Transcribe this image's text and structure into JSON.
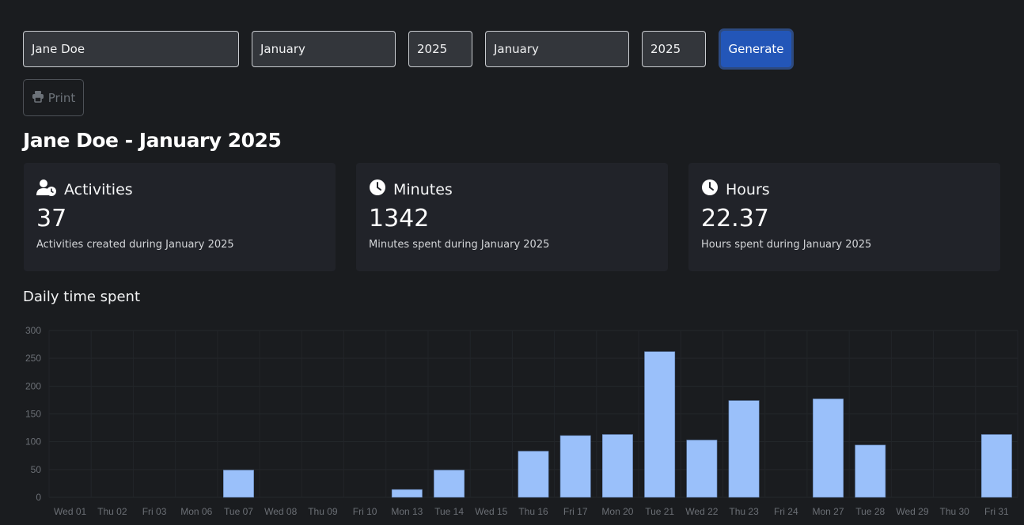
{
  "form": {
    "name_value": "Jane Doe",
    "start_month": "January",
    "start_year": "2025",
    "end_month": "January",
    "end_year": "2025",
    "generate_label": "Generate",
    "print_label": "Print",
    "print_icon": "printer-icon"
  },
  "report": {
    "title": "Jane Doe - January 2025"
  },
  "cards": [
    {
      "icon": "user-clock-icon",
      "title": "Activities",
      "value": "37",
      "description": "Activities created during January 2025"
    },
    {
      "icon": "clock-icon",
      "title": "Minutes",
      "value": "1342",
      "description": "Minutes spent during January 2025"
    },
    {
      "icon": "clock-icon",
      "title": "Hours",
      "value": "22.37",
      "description": "Hours spent during January 2025"
    }
  ],
  "chart_section": {
    "title": "Daily time spent"
  },
  "colors": {
    "bar": "#9ac0fa",
    "accent": "#2356b8"
  },
  "chart_data": {
    "type": "bar",
    "title": "Daily time spent",
    "xlabel": "",
    "ylabel": "",
    "ylim": [
      0,
      300
    ],
    "yticks": [
      0,
      50,
      100,
      150,
      200,
      250,
      300
    ],
    "grid": true,
    "legend": "none",
    "categories": [
      "Wed 01",
      "Thu 02",
      "Fri 03",
      "Mon 06",
      "Tue 07",
      "Wed 08",
      "Thu 09",
      "Fri 10",
      "Mon 13",
      "Tue 14",
      "Wed 15",
      "Thu 16",
      "Fri 17",
      "Mon 20",
      "Tue 21",
      "Wed 22",
      "Thu 23",
      "Fri 24",
      "Mon 27",
      "Tue 28",
      "Wed 29",
      "Thu 30",
      "Fri 31"
    ],
    "values": [
      0,
      0,
      0,
      0,
      49,
      0,
      0,
      0,
      14,
      49,
      0,
      83,
      111,
      113,
      262,
      103,
      174,
      0,
      177,
      94,
      0,
      0,
      113
    ]
  }
}
